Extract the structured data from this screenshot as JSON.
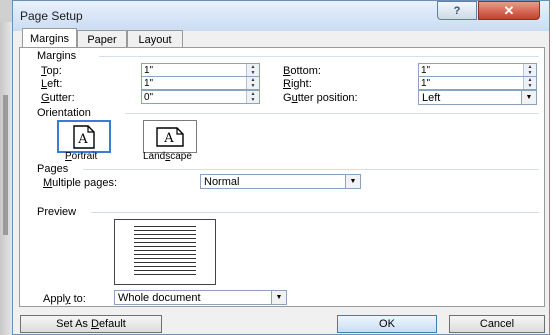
{
  "window": {
    "title": "Page Setup"
  },
  "title_buttons": {
    "help": "?",
    "close": "✕"
  },
  "tabs": [
    {
      "label": "Margins",
      "active": true
    },
    {
      "label": "Paper",
      "active": false
    },
    {
      "label": "Layout",
      "active": false
    }
  ],
  "margins": {
    "heading": "Margins",
    "top": {
      "label_pre": "",
      "label_u": "T",
      "label_post": "op:",
      "value": "1\""
    },
    "bottom": {
      "label_pre": "",
      "label_u": "B",
      "label_post": "ottom:",
      "value": "1\""
    },
    "left": {
      "label_pre": "",
      "label_u": "L",
      "label_post": "eft:",
      "value": "1\""
    },
    "right": {
      "label_pre": "",
      "label_u": "R",
      "label_post": "ight:",
      "value": "1\""
    },
    "gutter": {
      "label_pre": "",
      "label_u": "G",
      "label_post": "utter:",
      "value": "0\""
    },
    "gutter_position": {
      "label_pre": "G",
      "label_u": "u",
      "label_post": "tter position:",
      "value": "Left"
    }
  },
  "orientation": {
    "heading": "Orientation",
    "portrait": {
      "label_pre": "",
      "label_u": "P",
      "label_post": "ortrait",
      "selected": true
    },
    "landscape": {
      "label_pre": "Land",
      "label_u": "s",
      "label_post": "cape",
      "selected": false
    }
  },
  "pages": {
    "heading": "Pages",
    "multiple_label_pre": "",
    "multiple_label_u": "M",
    "multiple_label_post": "ultiple pages:",
    "multiple_value": "Normal"
  },
  "preview": {
    "heading": "Preview"
  },
  "apply": {
    "label_pre": "Appl",
    "label_u": "y",
    "label_post": " to:",
    "value": "Whole document"
  },
  "buttons": {
    "set_default_pre": "Set As ",
    "set_default_u": "D",
    "set_default_post": "efault",
    "ok": "OK",
    "cancel": "Cancel"
  },
  "colors": {
    "accent": "#3a7bd5",
    "titlebar": "#d7e5f7",
    "close": "#c4402d",
    "dialog_bg": "#f0f0f0"
  }
}
